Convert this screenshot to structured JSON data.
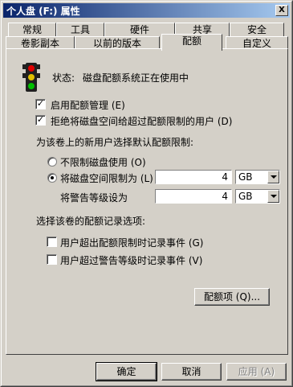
{
  "window": {
    "title": "个人盘 (F:) 属性",
    "close_glyph": "X"
  },
  "tabs_row_back": [
    "常规",
    "工具",
    "硬件",
    "共享",
    "安全"
  ],
  "tabs_row_front": [
    "卷影副本",
    "以前的版本",
    "配额",
    "自定义"
  ],
  "active_tab": "配额",
  "quota": {
    "status_label": "状态:",
    "status_text": "磁盘配额系统正在使用中",
    "enable_label": "启用配额管理 (E)",
    "enable_checked": true,
    "deny_label": "拒绝将磁盘空间给超过配额限制的用户 (D)",
    "deny_checked": true,
    "default_limit_heading": "为该卷上的新用户选择默认配额限制:",
    "no_limit_label": "不限制磁盘使用 (O)",
    "limit_label": "将磁盘空间限制为 (L)",
    "limit_value": "4",
    "limit_unit": "GB",
    "warning_label": "将警告等级设为",
    "warning_value": "4",
    "warning_unit": "GB",
    "selected_option": "limit",
    "log_heading": "选择该卷的配额记录选项:",
    "log_exceed_limit_label": "用户超出配额限制时记录事件 (G)",
    "log_exceed_limit_checked": false,
    "log_exceed_warning_label": "用户超过警告等级时记录事件 (V)",
    "log_exceed_warning_checked": false,
    "entries_button": "配额项 (Q)..."
  },
  "footer": {
    "ok": "确定",
    "cancel": "取消",
    "apply": "应用 (A)"
  },
  "colors": {
    "title_gradient_start": "#0a246a",
    "title_gradient_end": "#a6caf0",
    "face": "#d4d0c8"
  },
  "icons": {
    "traffic_light": "traffic-light-icon"
  }
}
